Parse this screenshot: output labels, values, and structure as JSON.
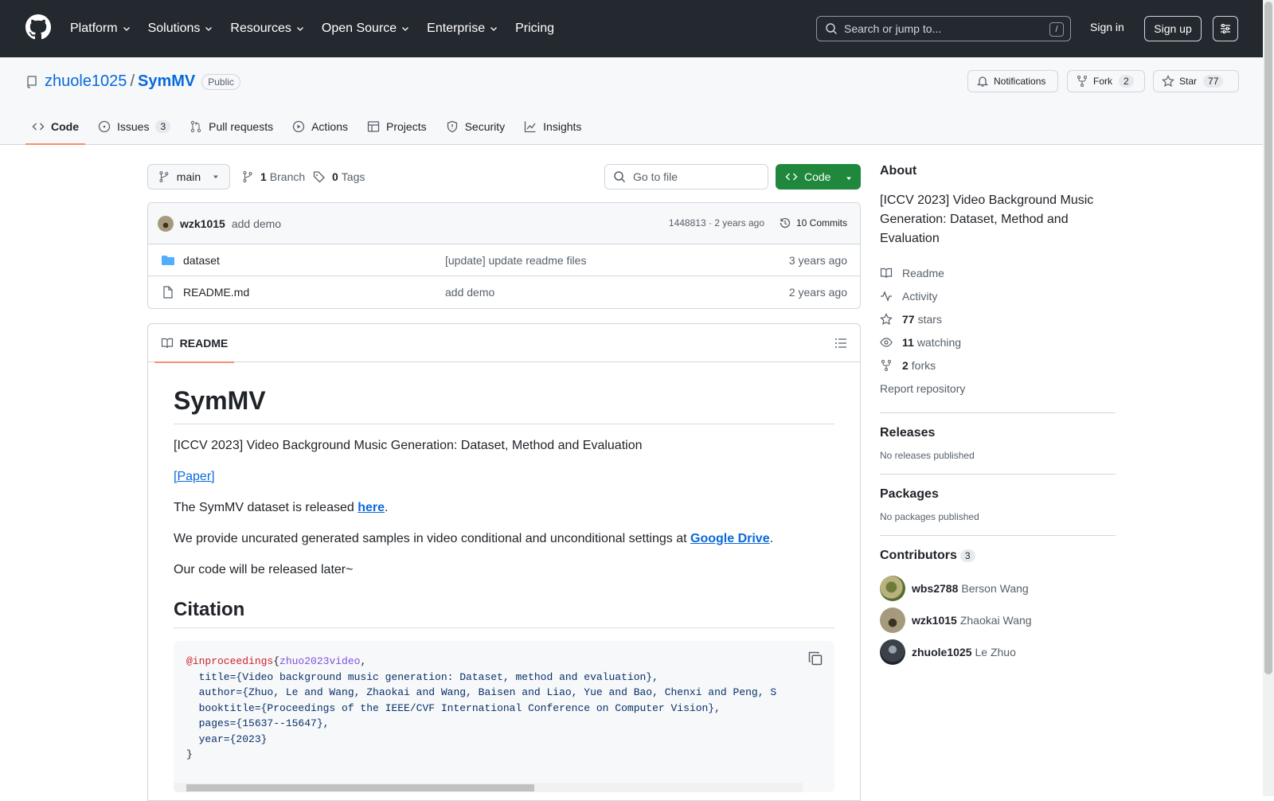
{
  "topbar": {
    "nav": [
      "Platform",
      "Solutions",
      "Resources",
      "Open Source",
      "Enterprise",
      "Pricing"
    ],
    "search_placeholder": "Search or jump to...",
    "search_shortcut": "/",
    "signin": "Sign in",
    "signup": "Sign up"
  },
  "repo": {
    "owner": "zhuole1025",
    "separator": "/",
    "name": "SymMV",
    "visibility": "Public",
    "notifications": "Notifications",
    "fork_label": "Fork",
    "fork_count": "2",
    "star_label": "Star",
    "star_count": "77"
  },
  "tabs": [
    {
      "label": "Code",
      "count": ""
    },
    {
      "label": "Issues",
      "count": "3"
    },
    {
      "label": "Pull requests",
      "count": ""
    },
    {
      "label": "Actions",
      "count": ""
    },
    {
      "label": "Projects",
      "count": ""
    },
    {
      "label": "Security",
      "count": ""
    },
    {
      "label": "Insights",
      "count": ""
    }
  ],
  "toolbar": {
    "branch": "main",
    "branches_count": "1",
    "branches_label": "Branch",
    "tags_count": "0",
    "tags_label": "Tags",
    "goto_placeholder": "Go to file",
    "code_button": "Code"
  },
  "commit": {
    "user": "wzk1015",
    "message": "add demo",
    "meta": "1448813 · 2 years ago",
    "commits": "10 Commits"
  },
  "files": [
    {
      "name": "dataset",
      "message": "[update] update readme files",
      "age": "3 years ago",
      "type": "folder"
    },
    {
      "name": "README.md",
      "message": "add demo",
      "age": "2 years ago",
      "type": "file"
    }
  ],
  "readme": {
    "tab": "README",
    "title": "SymMV",
    "intro": "[ICCV 2023] Video Background Music Generation: Dataset, Method and Evaluation",
    "paper_link": "[Paper]",
    "dataset_text": "The SymMV dataset is released ",
    "dataset_link": "here",
    "dataset_end": ".",
    "samples_text": "We provide uncurated generated samples in video conditional and unconditional settings at ",
    "samples_link": "Google Drive",
    "samples_end": ".",
    "code_text": "Our code will be released later~",
    "citation_title": "Citation",
    "bib_kw": "@inproceedings",
    "bib_open": "{",
    "bib_key": "zhuo2023video",
    "bib_comma": ",",
    "bib_lines": [
      "  title={Video background music generation: Dataset, method and evaluation},",
      "  author={Zhuo, Le and Wang, Zhaokai and Wang, Baisen and Liao, Yue and Bao, Chenxi and Peng, S",
      "  booktitle={Proceedings of the IEEE/CVF International Conference on Computer Vision},",
      "  pages={15637--15647},",
      "  year={2023}",
      "}"
    ]
  },
  "about": {
    "title": "About",
    "description": "[ICCV 2023] Video Background Music Generation: Dataset, Method and Evaluation",
    "readme": "Readme",
    "activity": "Activity",
    "stars_count": "77",
    "stars_label": "stars",
    "watching_count": "11",
    "watching_label": "watching",
    "forks_count": "2",
    "forks_label": "forks",
    "report": "Report repository"
  },
  "releases": {
    "title": "Releases",
    "empty": "No releases published"
  },
  "packages": {
    "title": "Packages",
    "empty": "No packages published"
  },
  "contributors": {
    "title": "Contributors",
    "count": "3",
    "list": [
      {
        "login": "wbs2788",
        "name": "Berson Wang"
      },
      {
        "login": "wzk1015",
        "name": "Zhaokai Wang"
      },
      {
        "login": "zhuole1025",
        "name": "Le Zhuo"
      }
    ]
  }
}
